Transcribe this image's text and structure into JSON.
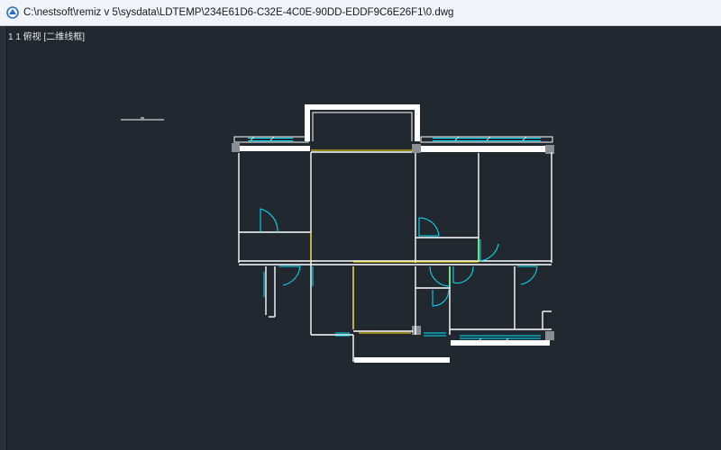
{
  "window": {
    "title": "C:\\nestsoft\\remiz v 5\\sysdata\\LDTEMP\\234E61D6-C32E-4C0E-90DD-EDDF9C6E26F1\\0.dwg",
    "icon": "app-logo-icon"
  },
  "viewport": {
    "view_label": "1 1 俯视 [二维线框]",
    "background": "#212830",
    "line_colors": {
      "wall": "#ffffff",
      "door": "#00e5ff",
      "axis": "#ffe600",
      "dim": "#7fff7f",
      "column": "#8a8f96"
    }
  }
}
